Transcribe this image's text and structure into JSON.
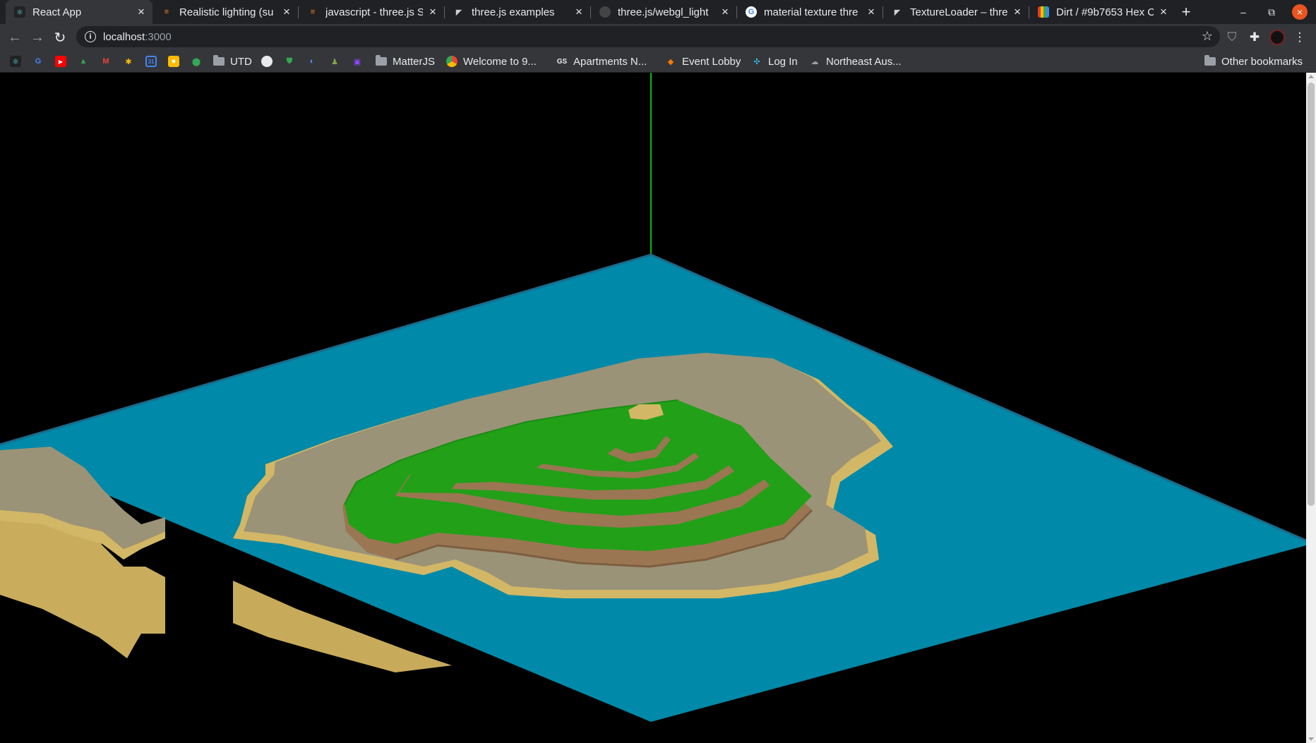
{
  "browser": {
    "tabs": [
      {
        "label": "React App",
        "icon": "react-icon",
        "icon_color": "#61dafb",
        "active": true
      },
      {
        "label": "Realistic lighting (su",
        "icon": "stackoverflow-icon",
        "icon_color": "#f48024",
        "active": false
      },
      {
        "label": "javascript - three.js S",
        "icon": "stackoverflow-icon",
        "icon_color": "#f48024",
        "active": false
      },
      {
        "label": "three.js examples",
        "icon": "threejs-icon",
        "icon_color": "#cfcfcf",
        "active": false
      },
      {
        "label": "three.js/webgl_light",
        "icon": "github-icon",
        "icon_color": "#444444",
        "active": false
      },
      {
        "label": "material texture thre",
        "icon": "google-icon",
        "icon_color": "#4285f4",
        "active": false
      },
      {
        "label": "TextureLoader – thre",
        "icon": "threejs-icon",
        "icon_color": "#cfcfcf",
        "active": false
      },
      {
        "label": "Dirt / #9b7653 Hex C",
        "icon": "colorhexa-icon",
        "icon_color": "#e53935",
        "active": false
      }
    ],
    "new_tab_label": "+",
    "address": {
      "host": "localhost",
      "port": ":3000"
    },
    "bookmarks": [
      {
        "label": "",
        "icon": "react-icon",
        "icon_color": "#61dafb"
      },
      {
        "label": "",
        "icon": "google-icon",
        "icon_color": "#4285f4"
      },
      {
        "label": "",
        "icon": "youtube-icon",
        "icon_color": "#ff0000"
      },
      {
        "label": "",
        "icon": "drive-icon",
        "icon_color": "#34a853"
      },
      {
        "label": "",
        "icon": "gmail-icon",
        "icon_color": "#ea4335"
      },
      {
        "label": "",
        "icon": "photos-icon",
        "icon_color": "#fbbc04"
      },
      {
        "label": "",
        "icon": "calendar-icon",
        "icon_color": "#4285f4"
      },
      {
        "label": "",
        "icon": "keep-icon",
        "icon_color": "#fbbc04"
      },
      {
        "label": "",
        "icon": "maps-icon",
        "icon_color": "#34a853"
      },
      {
        "label": "UTD",
        "icon": "folder-icon",
        "icon_color": "#9aa0a6"
      },
      {
        "label": "",
        "icon": "github-icon",
        "icon_color": "#e8eaed"
      },
      {
        "label": "",
        "icon": "shield-icon",
        "icon_color": "#34a853"
      },
      {
        "label": "",
        "icon": "sync-icon",
        "icon_color": "#4f8cf7"
      },
      {
        "label": "",
        "icon": "chess-icon",
        "icon_color": "#7fa650"
      },
      {
        "label": "",
        "icon": "twitch-icon",
        "icon_color": "#9146ff"
      },
      {
        "label": "MatterJS",
        "icon": "folder-icon",
        "icon_color": "#9aa0a6"
      },
      {
        "label": "Welcome to 9...",
        "icon": "chrome-icon",
        "icon_color": "#fbbc04"
      },
      {
        "label": "Apartments N...",
        "icon": "gs-icon",
        "icon_color": "#e8eaed"
      },
      {
        "label": "Event Lobby",
        "icon": "event-icon",
        "icon_color": "#ff7a00"
      },
      {
        "label": "Log In",
        "icon": "slack-icon",
        "icon_color": "#36c5f0"
      },
      {
        "label": "Northeast Aus...",
        "icon": "link-icon",
        "icon_color": "#9aa0a6"
      }
    ],
    "other_bookmarks_label": "Other bookmarks"
  },
  "scene": {
    "background": "#000000",
    "water_color": "#0089a8",
    "sand_color": "#d2b766",
    "stone_color": "#9b9378",
    "grass_color": "#22a018",
    "dirt_color": "#9b7653",
    "axis_color": "#00c000"
  }
}
